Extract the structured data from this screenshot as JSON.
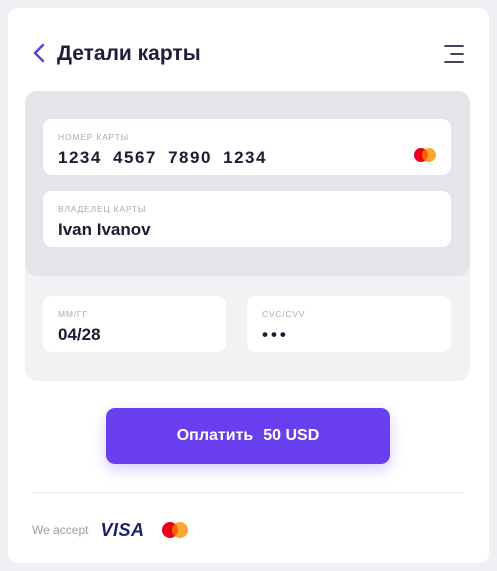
{
  "header": {
    "title": "Детали карты",
    "back_icon": "chevron-left-icon",
    "menu_icon": "menu-icon"
  },
  "card_form": {
    "card_number": {
      "label": "НОМЕР КАРТЫ",
      "value": "1234  4567  7890  1234"
    },
    "card_owner": {
      "label": "ВЛАДЕЛЕЦ КАРТЫ",
      "value": "Ivan Ivanov"
    },
    "expiry": {
      "label": "ММ/ГГ",
      "value": "04/28"
    },
    "cvc": {
      "label": "CVC/CVV",
      "value": "•••"
    },
    "brand_icon": "mastercard-icon"
  },
  "pay_button": {
    "label": "Оплатить",
    "amount": "50 USD"
  },
  "footer": {
    "accept_label": "We accept",
    "visa_label": "VISA",
    "mastercard_icon": "mastercard-icon"
  },
  "colors": {
    "accent": "#6a3ff0",
    "text_dark": "#1f1b3d",
    "panel_bg": "#e4e4ea",
    "mastercard_red": "#eb001b",
    "mastercard_orange": "#f79e1b"
  }
}
